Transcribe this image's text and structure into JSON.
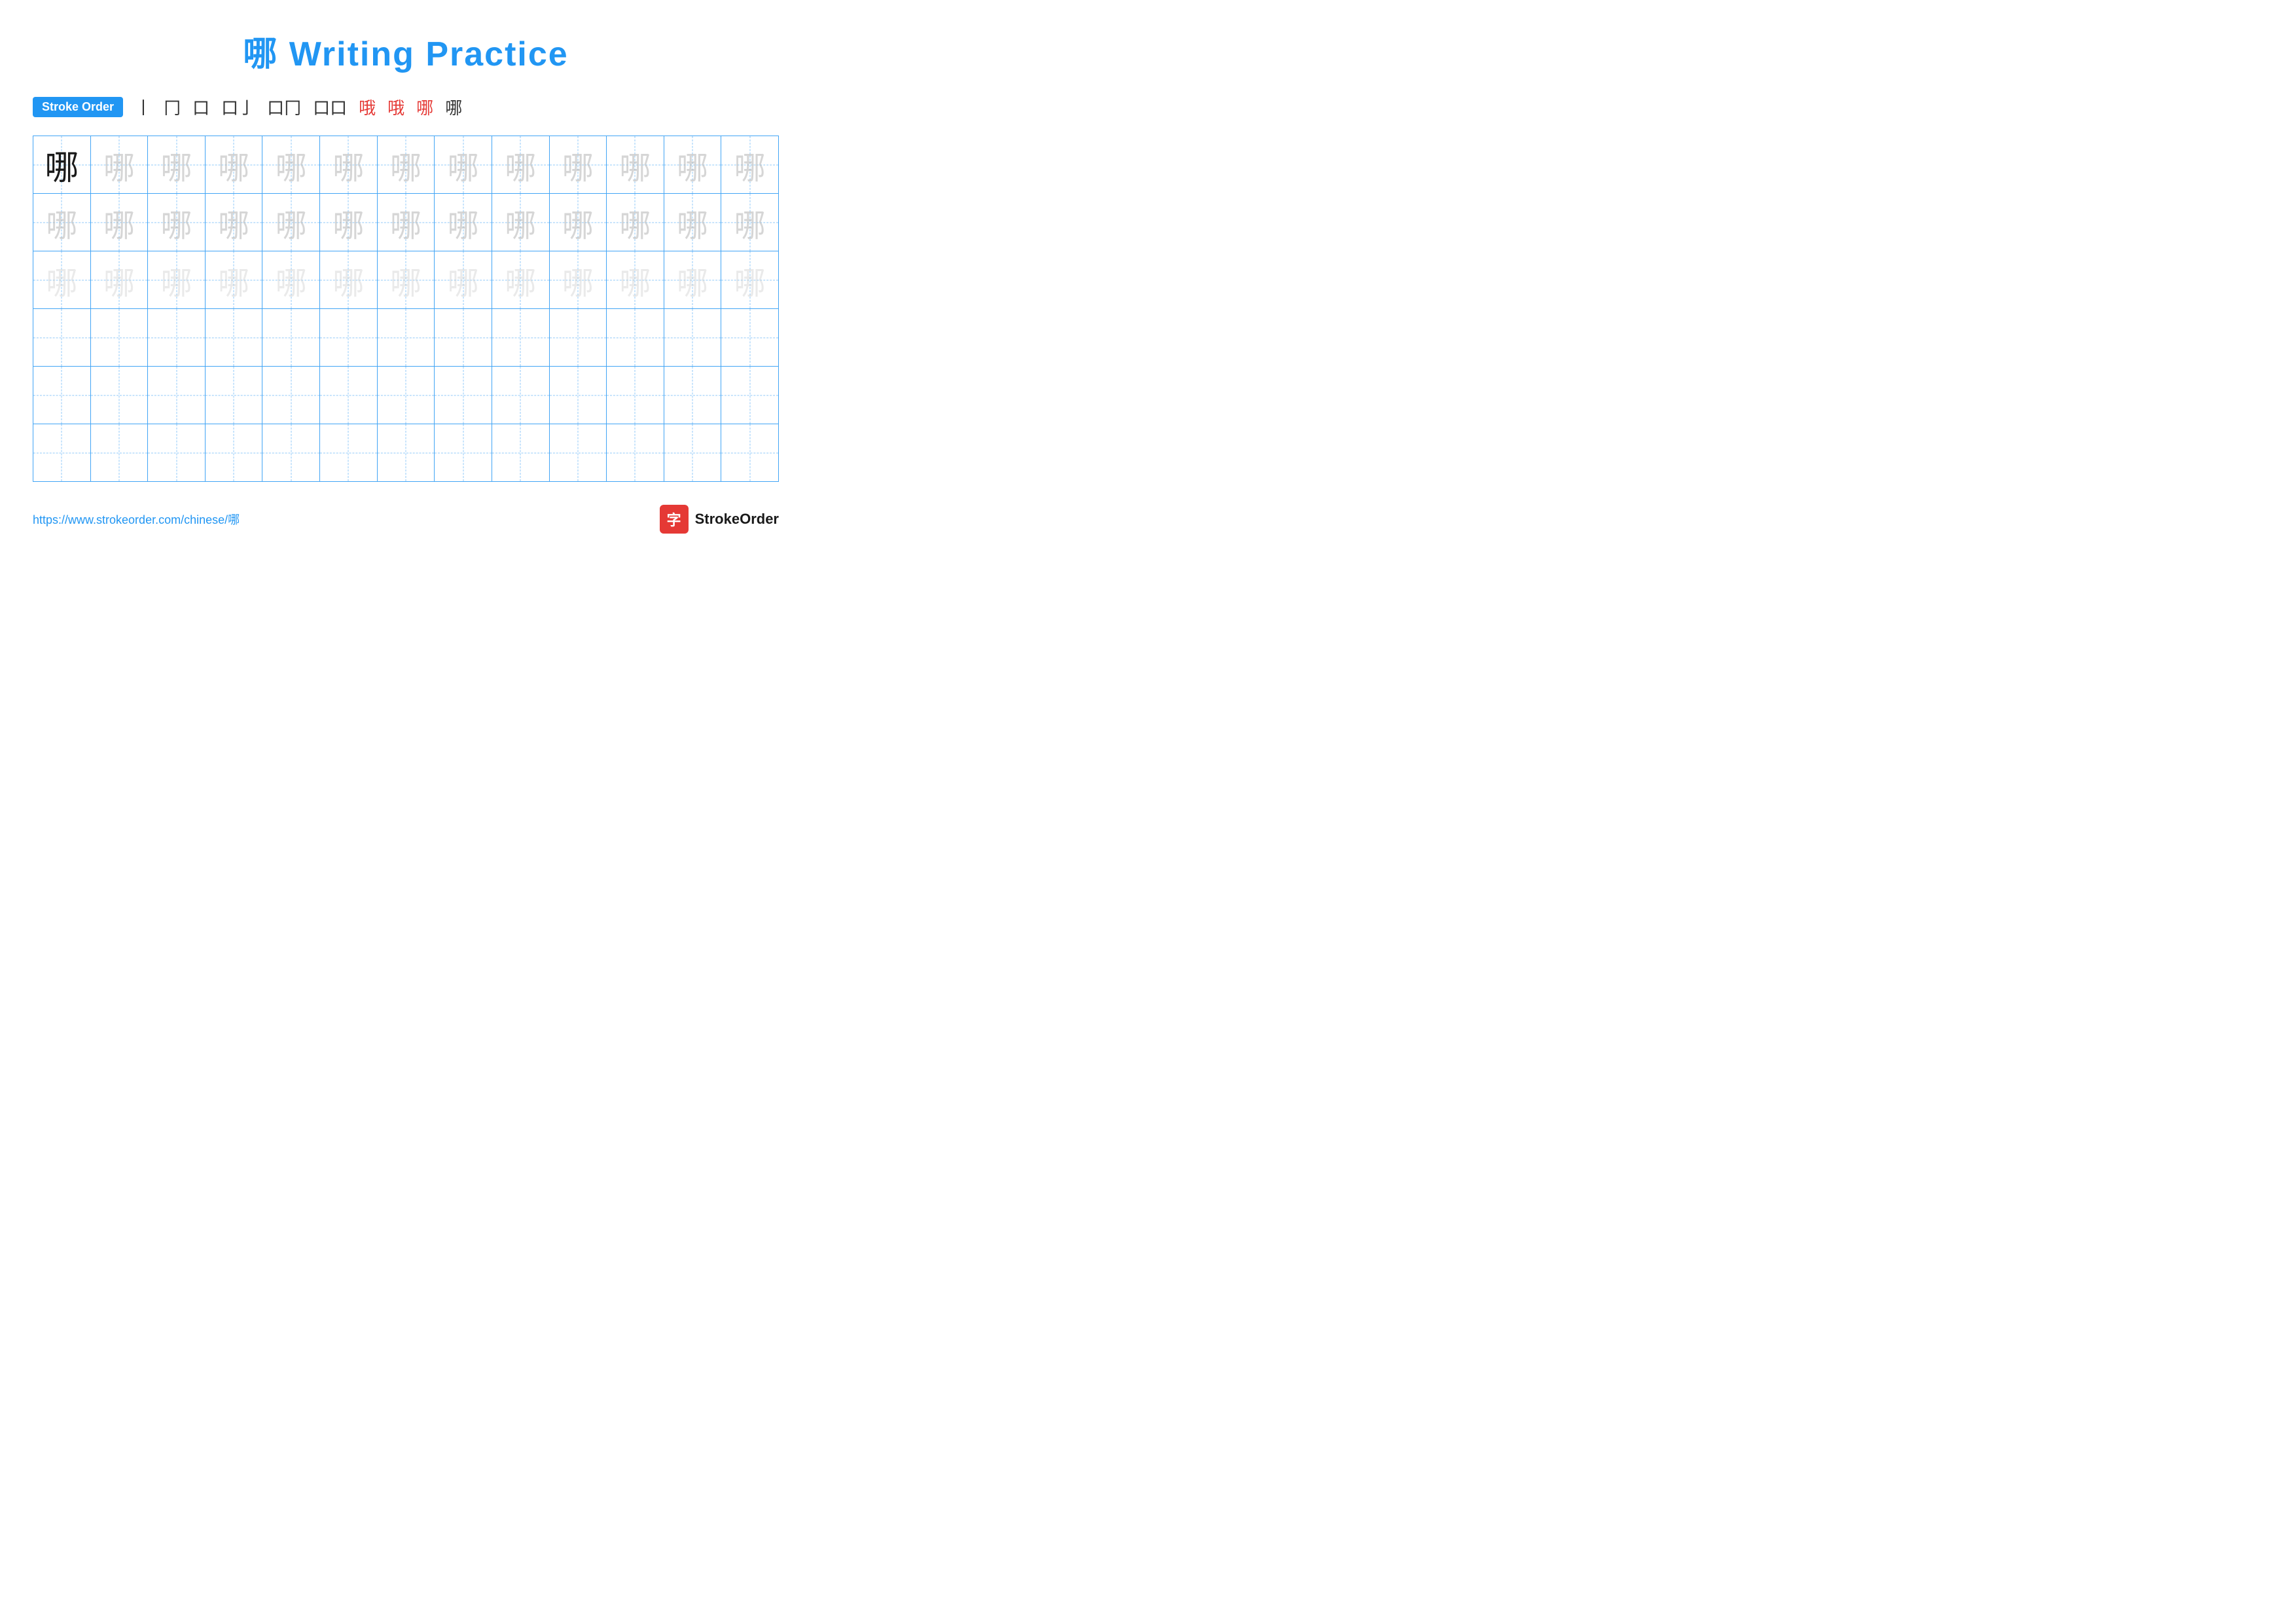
{
  "page": {
    "title": "哪 Writing Practice",
    "url": "https://www.strokeorder.com/chinese/哪",
    "brand": "StrokeOrder"
  },
  "stroke_order": {
    "label": "Stroke Order",
    "steps": [
      "丨",
      "冂",
      "口",
      "口亅",
      "口冂",
      "口口",
      "哪⁰",
      "哪¹",
      "哪²",
      "哪"
    ]
  },
  "grid": {
    "rows": 6,
    "cols": 13,
    "character": "哪",
    "row1_type": "solid+faint",
    "row2_type": "faint",
    "row3_type": "lighter",
    "row4_type": "empty",
    "row5_type": "empty",
    "row6_type": "empty"
  },
  "footer": {
    "url_text": "https://www.strokeorder.com/chinese/哪",
    "brand_text": "StrokeOrder",
    "brand_icon_char": "字"
  }
}
